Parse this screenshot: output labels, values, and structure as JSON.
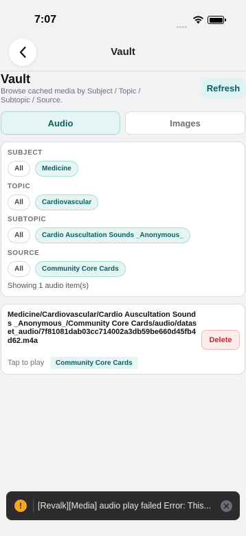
{
  "status_bar": {
    "time": "7:07"
  },
  "nav": {
    "title": "Vault"
  },
  "header": {
    "title": "Vault",
    "subtitle": "Browse cached media by Subject / Topic / Subtopic / Source.",
    "refresh_label": "Refresh"
  },
  "tabs": [
    {
      "label": "Audio",
      "active": true
    },
    {
      "label": "Images",
      "active": false
    }
  ],
  "filters": [
    {
      "label": "SUBJECT",
      "all": "All",
      "selected": "Medicine"
    },
    {
      "label": "TOPIC",
      "all": "All",
      "selected": "Cardiovascular"
    },
    {
      "label": "SUBTOPIC",
      "all": "All",
      "selected": "Cardio Auscultation Sounds _Anonymous_"
    },
    {
      "label": "SOURCE",
      "all": "All",
      "selected": "Community Core Cards"
    }
  ],
  "summary": "Showing 1 audio item(s)",
  "items": [
    {
      "path": "Medicine/Cardiovascular/Cardio Auscultation Sounds _Anonymous_/Community Core Cards/audio/dataset_audio/7f81081dab03cc714002a3db59be660d45fb4d62.m4a",
      "delete_label": "Delete",
      "hint": "Tap to play",
      "source": "Community Core Cards"
    }
  ],
  "toast": {
    "icon": "warning-icon",
    "icon_glyph": "!",
    "message": "[Revalk][Media] audio play failed Error: This..."
  },
  "colors": {
    "accent": "#0c5f63",
    "accent_bg": "#e4f5f3",
    "danger": "#c9282d",
    "toast_bg": "#2c2c2e",
    "warning": "#f4a623"
  }
}
